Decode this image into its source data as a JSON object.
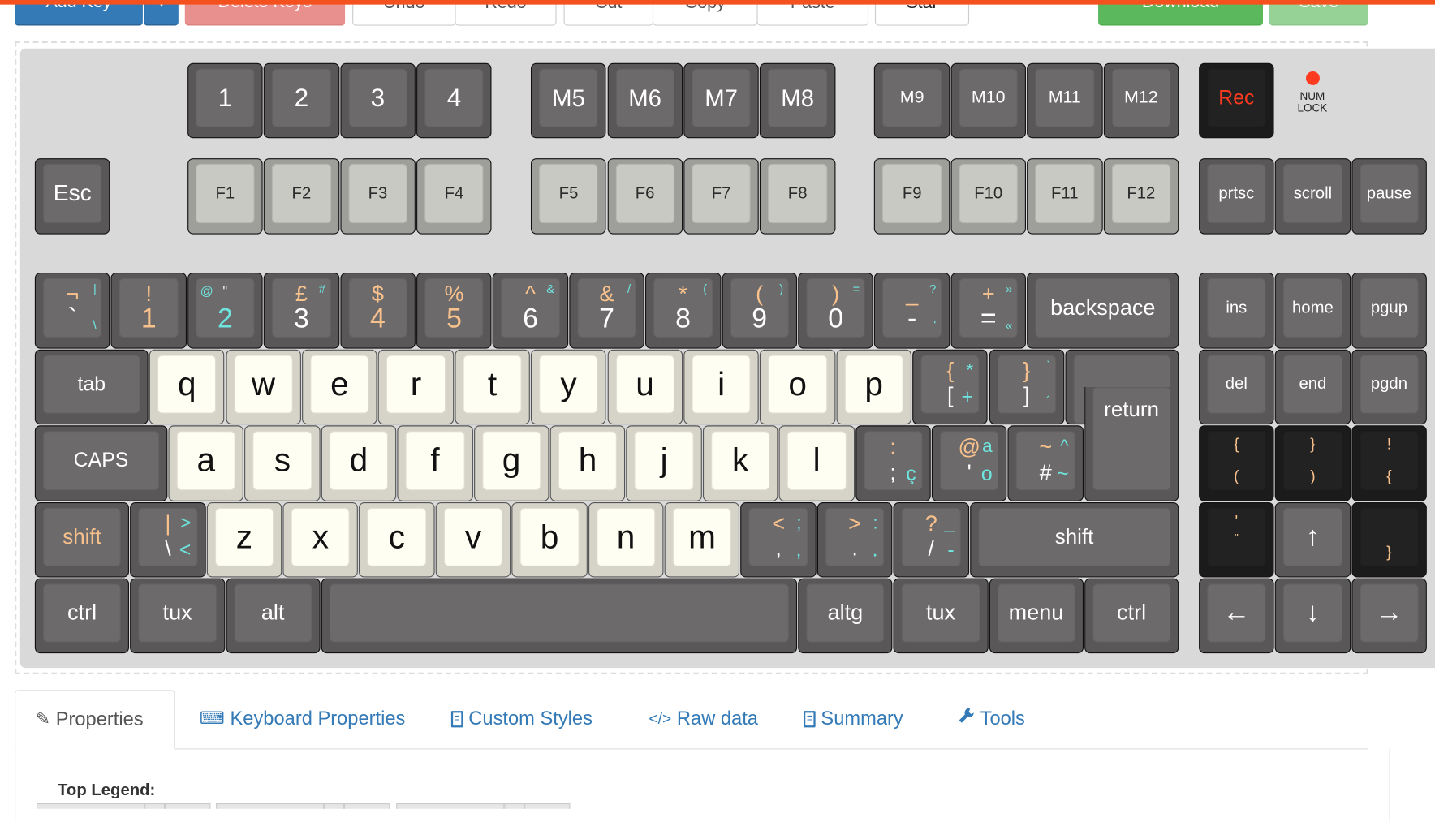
{
  "toolbar": {
    "add_key": "Add Key",
    "delete_keys": "Delete Keys",
    "undo": "Undo",
    "redo": "Redo",
    "cut": "Cut",
    "copy": "Copy",
    "paste": "Paste",
    "star": "Star",
    "download": "Download",
    "save": "Save"
  },
  "colors": {
    "accent_bar": "#f4511e",
    "orange": "#f9c28d",
    "cyan": "#6ee6e0",
    "white": "#ffffff",
    "red": "#ff3b1f"
  },
  "indicator": {
    "line1": "NUM",
    "line2": "LOCK"
  },
  "keys": [
    {
      "label": "1",
      "style": "dark"
    },
    {
      "label": "2",
      "style": "dark"
    },
    {
      "label": "3",
      "style": "dark"
    },
    {
      "label": "4",
      "style": "dark"
    },
    {
      "label": "M5",
      "style": "dark"
    },
    {
      "label": "M6",
      "style": "dark"
    },
    {
      "label": "M7",
      "style": "dark"
    },
    {
      "label": "M8",
      "style": "dark"
    },
    {
      "label": "M9",
      "style": "dark"
    },
    {
      "label": "M10",
      "style": "dark"
    },
    {
      "label": "M11",
      "style": "dark"
    },
    {
      "label": "M12",
      "style": "dark"
    },
    {
      "label": "Rec",
      "style": "black",
      "color": "red"
    },
    {
      "label": "Esc",
      "style": "dark"
    },
    {
      "label": "F1",
      "style": "light"
    },
    {
      "label": "F2",
      "style": "light"
    },
    {
      "label": "F3",
      "style": "light"
    },
    {
      "label": "F4",
      "style": "light"
    },
    {
      "label": "F5",
      "style": "light"
    },
    {
      "label": "F6",
      "style": "light"
    },
    {
      "label": "F7",
      "style": "light"
    },
    {
      "label": "F8",
      "style": "light"
    },
    {
      "label": "F9",
      "style": "light"
    },
    {
      "label": "F10",
      "style": "light"
    },
    {
      "label": "F11",
      "style": "light"
    },
    {
      "label": "F12",
      "style": "light"
    },
    {
      "label": "prtsc",
      "style": "dark"
    },
    {
      "label": "scroll",
      "style": "dark"
    },
    {
      "label": "pause",
      "style": "dark"
    },
    {
      "style": "dark",
      "legends": [
        [
          "¬",
          "tc",
          "orange"
        ],
        [
          "|",
          "tr",
          "cyan"
        ],
        [
          "`",
          "bc",
          "white"
        ],
        [
          "\\",
          "br",
          "cyan"
        ]
      ]
    },
    {
      "style": "dark",
      "legends": [
        [
          "!",
          "tc",
          "orange"
        ],
        [
          "1",
          "bc",
          "orange"
        ]
      ]
    },
    {
      "style": "dark",
      "legends": [
        [
          "@",
          "tl",
          "cyan"
        ],
        [
          "\"",
          "tcs",
          "white"
        ],
        [
          "2",
          "bc",
          "cyan"
        ]
      ]
    },
    {
      "style": "dark",
      "legends": [
        [
          "£",
          "tc",
          "orange"
        ],
        [
          "#",
          "tr",
          "cyan"
        ],
        [
          "3",
          "bc",
          "white"
        ]
      ]
    },
    {
      "style": "dark",
      "legends": [
        [
          "$",
          "tc",
          "orange"
        ],
        [
          "4",
          "bc",
          "orange"
        ]
      ]
    },
    {
      "style": "dark",
      "legends": [
        [
          "%",
          "tc",
          "orange"
        ],
        [
          "5",
          "bc",
          "orange"
        ]
      ]
    },
    {
      "style": "dark",
      "legends": [
        [
          "^",
          "tc",
          "orange"
        ],
        [
          "&",
          "tr",
          "cyan"
        ],
        [
          "6",
          "bc",
          "white"
        ]
      ]
    },
    {
      "style": "dark",
      "legends": [
        [
          "&",
          "tc",
          "orange"
        ],
        [
          "/",
          "tr",
          "cyan"
        ],
        [
          "7",
          "bc",
          "white"
        ]
      ]
    },
    {
      "style": "dark",
      "legends": [
        [
          "*",
          "tc",
          "orange"
        ],
        [
          "(",
          "tr",
          "cyan"
        ],
        [
          "8",
          "bc",
          "white"
        ]
      ]
    },
    {
      "style": "dark",
      "legends": [
        [
          "(",
          "tc",
          "orange"
        ],
        [
          ")",
          "tr",
          "cyan"
        ],
        [
          "9",
          "bc",
          "white"
        ]
      ]
    },
    {
      "style": "dark",
      "legends": [
        [
          ")",
          "tc",
          "orange"
        ],
        [
          "=",
          "tr",
          "cyan"
        ],
        [
          "0",
          "bc",
          "white"
        ]
      ]
    },
    {
      "style": "dark",
      "legends": [
        [
          "_",
          "tc",
          "orange"
        ],
        [
          "?",
          "tr",
          "cyan"
        ],
        [
          "-",
          "bc",
          "white"
        ],
        [
          "'",
          "br",
          "cyan"
        ]
      ]
    },
    {
      "style": "dark",
      "legends": [
        [
          "+",
          "tc",
          "orange"
        ],
        [
          "»",
          "tr",
          "cyan"
        ],
        [
          "=",
          "bc",
          "white"
        ],
        [
          "«",
          "br",
          "cyan"
        ]
      ]
    },
    {
      "label": "backspace",
      "style": "dark"
    },
    {
      "label": "ins",
      "style": "dark"
    },
    {
      "label": "home",
      "style": "dark"
    },
    {
      "label": "pgup",
      "style": "dark"
    },
    {
      "label": "tab",
      "style": "dark"
    },
    {
      "label": "q",
      "style": "alpha"
    },
    {
      "label": "w",
      "style": "alpha"
    },
    {
      "label": "e",
      "style": "alpha"
    },
    {
      "label": "r",
      "style": "alpha"
    },
    {
      "label": "t",
      "style": "alpha"
    },
    {
      "label": "y",
      "style": "alpha"
    },
    {
      "label": "u",
      "style": "alpha"
    },
    {
      "label": "i",
      "style": "alpha"
    },
    {
      "label": "o",
      "style": "alpha"
    },
    {
      "label": "p",
      "style": "alpha"
    },
    {
      "style": "dark",
      "legends": [
        [
          "{",
          "tc",
          "orange"
        ],
        [
          "*",
          "tr2",
          "cyan"
        ],
        [
          "[",
          "bc2",
          "white"
        ],
        [
          "+",
          "br2",
          "cyan"
        ]
      ]
    },
    {
      "style": "dark",
      "legends": [
        [
          "}",
          "tc",
          "orange"
        ],
        [
          "`",
          "tr",
          "cyan"
        ],
        [
          "]",
          "bc2",
          "white"
        ],
        [
          "´",
          "br",
          "cyan"
        ]
      ]
    },
    {
      "label": "return",
      "style": "dark",
      "shape": "return"
    },
    {
      "label": "del",
      "style": "dark"
    },
    {
      "label": "end",
      "style": "dark"
    },
    {
      "label": "pgdn",
      "style": "dark"
    },
    {
      "label": "CAPS",
      "style": "dark"
    },
    {
      "label": "a",
      "style": "alpha"
    },
    {
      "label": "s",
      "style": "alpha"
    },
    {
      "label": "d",
      "style": "alpha"
    },
    {
      "label": "f",
      "style": "alpha"
    },
    {
      "label": "g",
      "style": "alpha"
    },
    {
      "label": "h",
      "style": "alpha"
    },
    {
      "label": "j",
      "style": "alpha"
    },
    {
      "label": "k",
      "style": "alpha"
    },
    {
      "label": "l",
      "style": "alpha"
    },
    {
      "style": "dark",
      "legends": [
        [
          ":",
          "tc",
          "orange"
        ],
        [
          ";",
          "bc2",
          "white"
        ],
        [
          "ç",
          "br2",
          "cyan"
        ]
      ]
    },
    {
      "style": "dark",
      "legends": [
        [
          "@",
          "tc",
          "orange"
        ],
        [
          "a",
          "tr2",
          "cyan"
        ],
        [
          "'",
          "bc2",
          "white"
        ],
        [
          "o",
          "br2",
          "cyan"
        ]
      ]
    },
    {
      "style": "dark",
      "legends": [
        [
          "~",
          "tc",
          "orange"
        ],
        [
          "^",
          "tr2",
          "cyan"
        ],
        [
          "#",
          "bc2",
          "white"
        ],
        [
          "~",
          "br2",
          "cyan"
        ]
      ]
    },
    {
      "style": "black",
      "legends": [
        [
          "{",
          "tc",
          "orange"
        ],
        [
          "(",
          "bc2",
          "orange"
        ]
      ]
    },
    {
      "style": "black",
      "legends": [
        [
          "}",
          "tc",
          "orange"
        ],
        [
          ")",
          "bc2",
          "orange"
        ]
      ]
    },
    {
      "style": "black",
      "legends": [
        [
          "!",
          "tc",
          "orange"
        ],
        [
          "{",
          "bc2",
          "orange"
        ]
      ]
    },
    {
      "label": "shift",
      "style": "dark",
      "color": "orange"
    },
    {
      "style": "dark",
      "legends": [
        [
          "|",
          "tc",
          "orange"
        ],
        [
          ">",
          "tr2",
          "cyan"
        ],
        [
          "\\",
          "bc2",
          "white"
        ],
        [
          "<",
          "br2",
          "cyan"
        ]
      ]
    },
    {
      "label": "z",
      "style": "alpha"
    },
    {
      "label": "x",
      "style": "alpha"
    },
    {
      "label": "c",
      "style": "alpha"
    },
    {
      "label": "v",
      "style": "alpha"
    },
    {
      "label": "b",
      "style": "alpha"
    },
    {
      "label": "n",
      "style": "alpha"
    },
    {
      "label": "m",
      "style": "alpha"
    },
    {
      "style": "dark",
      "legends": [
        [
          "<",
          "tc",
          "orange"
        ],
        [
          ";",
          "tr2",
          "cyan"
        ],
        [
          ",",
          "bc2",
          "white"
        ],
        [
          ",",
          "br2",
          "cyan"
        ]
      ]
    },
    {
      "style": "dark",
      "legends": [
        [
          ">",
          "tc",
          "orange"
        ],
        [
          ":",
          "tr2",
          "cyan"
        ],
        [
          ".",
          "bc2",
          "white"
        ],
        [
          ".",
          "br2",
          "cyan"
        ]
      ]
    },
    {
      "style": "dark",
      "legends": [
        [
          "?",
          "tc",
          "orange"
        ],
        [
          "_",
          "tr2",
          "cyan"
        ],
        [
          "/",
          "bc2",
          "white"
        ],
        [
          "-",
          "br2",
          "cyan"
        ]
      ]
    },
    {
      "label": "shift",
      "style": "dark"
    },
    {
      "style": "black",
      "legends": [
        [
          "'",
          "tc",
          "orange"
        ],
        [
          "\"",
          "mc",
          "orange"
        ]
      ]
    },
    {
      "label": "↑",
      "style": "dark"
    },
    {
      "style": "black",
      "legends": [
        [
          "}",
          "bc2",
          "orange"
        ]
      ]
    },
    {
      "label": "ctrl",
      "style": "dark"
    },
    {
      "label": "tux",
      "style": "dark"
    },
    {
      "label": "alt",
      "style": "dark"
    },
    {
      "label": "",
      "style": "dark"
    },
    {
      "label": "altg",
      "style": "dark"
    },
    {
      "label": "tux",
      "style": "dark"
    },
    {
      "label": "menu",
      "style": "dark"
    },
    {
      "label": "ctrl",
      "style": "dark"
    },
    {
      "label": "←",
      "style": "dark"
    },
    {
      "label": "↓",
      "style": "dark"
    },
    {
      "label": "→",
      "style": "dark"
    }
  ],
  "tabs": [
    {
      "label": "Properties",
      "icon": "edit-icon",
      "active": true
    },
    {
      "label": "Keyboard Properties",
      "icon": "keyboard-icon"
    },
    {
      "label": "Custom Styles",
      "icon": "document-icon"
    },
    {
      "label": "Raw data",
      "icon": "code-icon"
    },
    {
      "label": "Summary",
      "icon": "document-icon"
    },
    {
      "label": "Tools",
      "icon": "wrench-icon"
    }
  ],
  "panel": {
    "top_legend_label": "Top Legend:"
  }
}
